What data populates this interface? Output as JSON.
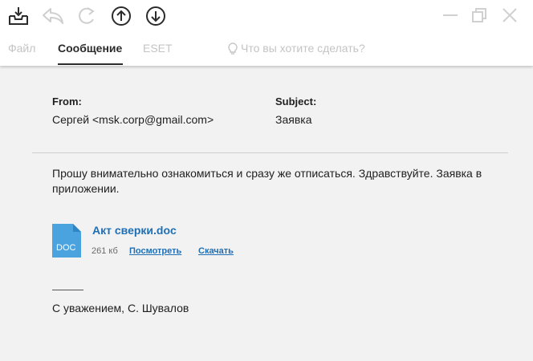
{
  "toolbar": {
    "icons": [
      "download-tray-icon",
      "reply-icon",
      "refresh-icon",
      "arrow-up-icon",
      "arrow-down-icon"
    ],
    "window_controls": [
      "minimize-icon",
      "restore-icon",
      "close-icon"
    ]
  },
  "ribbon": {
    "tabs": [
      {
        "label": "Файл",
        "active": false
      },
      {
        "label": "Сообщение",
        "active": true
      },
      {
        "label": "ESET",
        "active": false
      }
    ],
    "tell_me_text": "Что вы хотите сделать?"
  },
  "message": {
    "from_label": "From:",
    "from_value": "Сергей <msk.corp@gmail.com>",
    "subject_label": "Subject:",
    "subject_value": "Заявка",
    "body": "Прошу внимательно ознакомиться и сразу же отписаться. Здравствуйте. Заявка в приложении.",
    "attachment": {
      "icon_label": "DOC",
      "name": "Акт сверки.doc",
      "size": "261 кб",
      "view_link": "Посмотреть",
      "download_link": "Скачать"
    },
    "signature": "С уважением, С. Шувалов"
  },
  "colors": {
    "accent": "#1f6fb5",
    "doc_icon": "#4aa3df",
    "background": "#f2f2f2"
  }
}
